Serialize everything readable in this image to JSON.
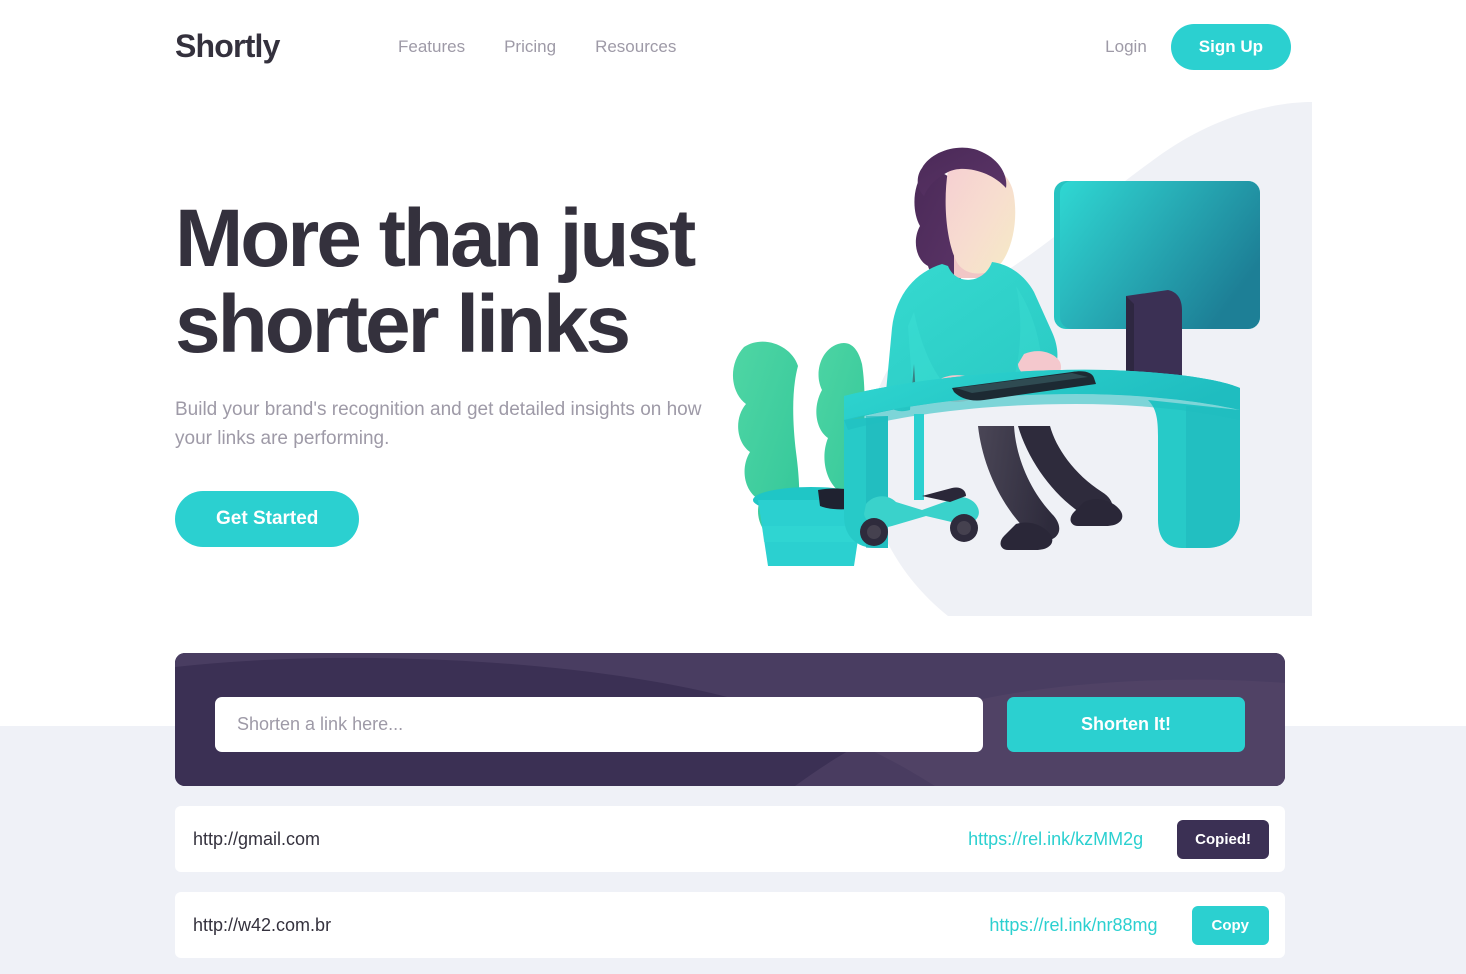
{
  "brand": {
    "name": "Shortly"
  },
  "nav": {
    "items": [
      {
        "label": "Features"
      },
      {
        "label": "Pricing"
      },
      {
        "label": "Resources"
      }
    ],
    "login_label": "Login",
    "signup_label": "Sign Up"
  },
  "hero": {
    "title_line1": "More than just",
    "title_line2": "shorter links",
    "subtitle": "Build your brand's recognition and get detailed insights on how your links are performing.",
    "cta_label": "Get Started",
    "illustration_name": "person-working-at-desk-illustration"
  },
  "shorten_form": {
    "input_value": "",
    "input_placeholder": "Shorten a link here...",
    "submit_label": "Shorten It!"
  },
  "results": [
    {
      "original_url": "http://gmail.com",
      "short_url": "https://rel.ink/kzMM2g",
      "button_label": "Copied!",
      "button_state": "copied"
    },
    {
      "original_url": "http://w42.com.br",
      "short_url": "https://rel.ink/nr88mg",
      "button_label": "Copy",
      "button_state": "copy"
    }
  ],
  "colors": {
    "accent_cyan": "#2bd0d0",
    "dark_violet": "#3b3054",
    "text_dark": "#34313d",
    "text_gray": "#9e9aa7",
    "band_gray": "#eff1f7",
    "blob_gray": "#eff1f6",
    "hair_purple": "#50315d",
    "leg_navy": "#35313f"
  }
}
